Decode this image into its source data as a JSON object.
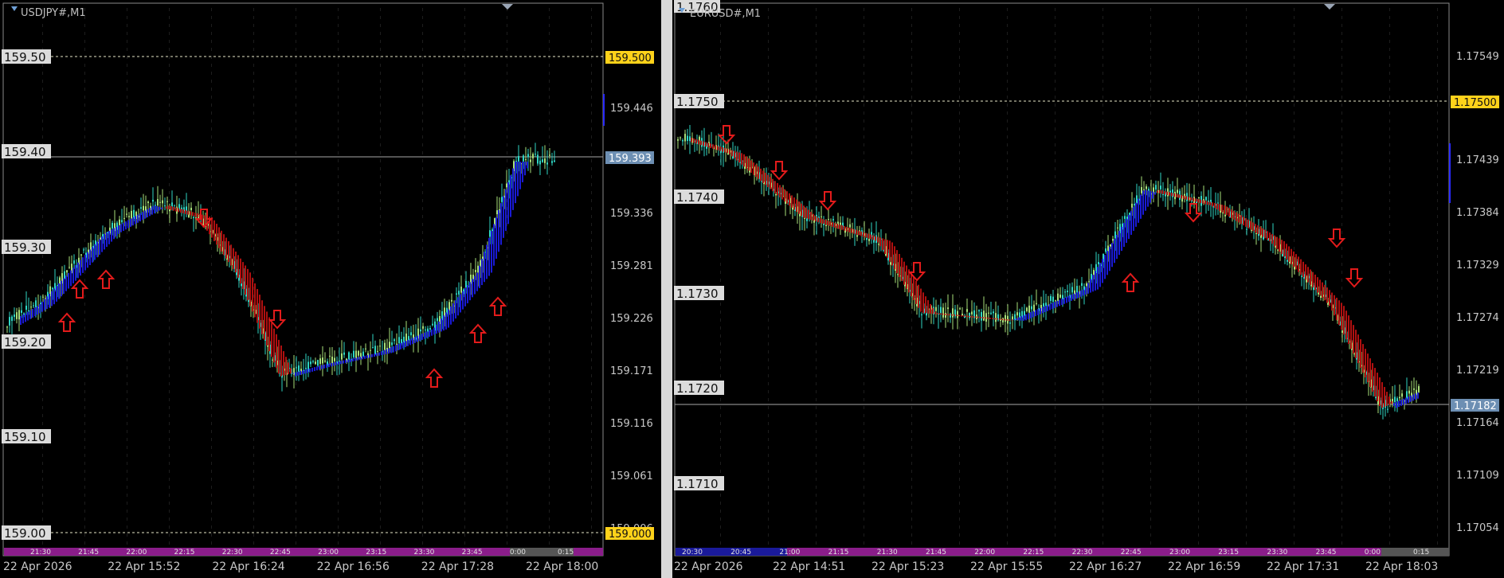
{
  "left_chart": {
    "title": "USDJPY#,M1",
    "level_labels": [
      "159.50",
      "159.40",
      "159.30",
      "159.20",
      "159.10",
      "159.00"
    ],
    "axis_ticks": [
      "159.446",
      "159.336",
      "159.281",
      "159.226",
      "159.171",
      "159.116",
      "159.061",
      "159.006"
    ],
    "tag_top": "159.500",
    "tag_current": "159.393",
    "tag_bottom": "159.000",
    "dates": [
      "22 Apr 2026",
      "22 Apr 15:52",
      "22 Apr 16:24",
      "22 Apr 16:56",
      "22 Apr 17:28",
      "22 Apr 18:00"
    ],
    "session_times": [
      "21:30",
      "21:45",
      "22:00",
      "22:15",
      "22:30",
      "22:45",
      "23:00",
      "23:15",
      "23:30",
      "23:45",
      "0:00",
      "0:15"
    ],
    "colors": {
      "tag_yellow": "#ffd21a",
      "tag_blue": "#6d8fb3",
      "bull": "#2fd6c4",
      "ribbon_up": "#1a1ad6",
      "ribbon_down": "#b01010",
      "arrow": "#e31b1b",
      "session": "#8a1d8a"
    }
  },
  "right_chart": {
    "title": "EURUSD#,M1",
    "level_labels": [
      "1.1760",
      "1.1750",
      "1.1740",
      "1.1730",
      "1.1720",
      "1.1710"
    ],
    "axis_ticks": [
      "1.17549",
      "1.17439",
      "1.17384",
      "1.17329",
      "1.17274",
      "1.17219",
      "1.17164",
      "1.17109",
      "1.17054"
    ],
    "tag_top": "1.17500",
    "tag_current": "1.17182",
    "dates": [
      "22 Apr 2026",
      "22 Apr 14:51",
      "22 Apr 15:23",
      "22 Apr 15:55",
      "22 Apr 16:27",
      "22 Apr 16:59",
      "22 Apr 17:31",
      "22 Apr 18:03"
    ],
    "session_times": [
      "20:30",
      "20:45",
      "21:00",
      "21:15",
      "21:30",
      "21:45",
      "22:00",
      "22:15",
      "22:30",
      "22:45",
      "23:00",
      "23:15",
      "23:30",
      "23:45",
      "0:00",
      "0:15"
    ]
  }
}
